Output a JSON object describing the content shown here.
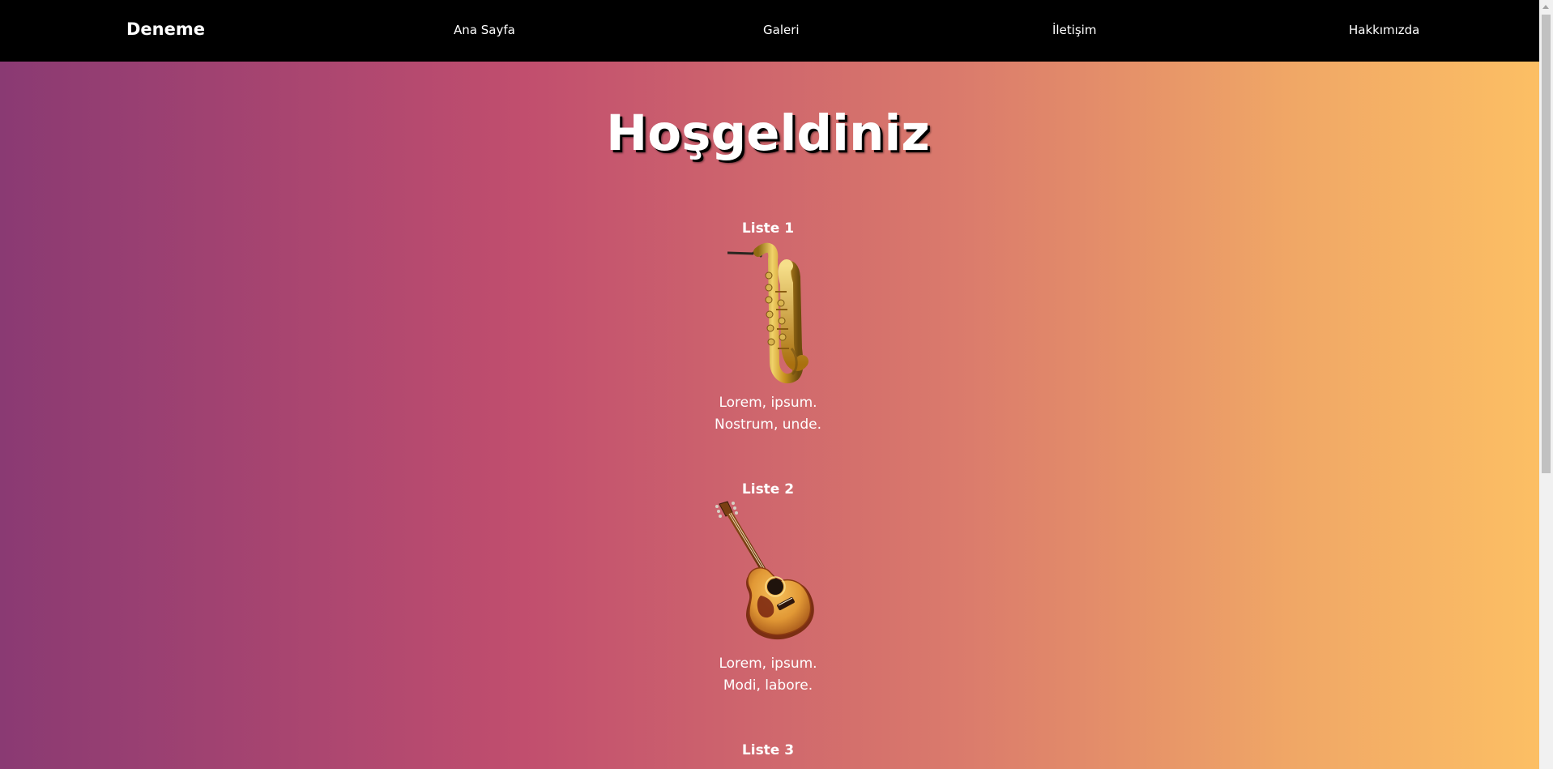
{
  "window": {
    "title": "Deneme"
  },
  "nav": {
    "brand": "Deneme",
    "links": [
      "Ana Sayfa",
      "Galeri",
      "İletişim",
      "Hakkımızda"
    ]
  },
  "hero": {
    "title": "Hoşgeldiniz"
  },
  "sections": [
    {
      "title": "Liste 1",
      "lines": [
        "Lorem, ipsum.",
        "Nostrum, unde."
      ],
      "image": "saxophone-image"
    },
    {
      "title": "Liste 2",
      "lines": [
        "Lorem, ipsum.",
        "Modi, labore."
      ],
      "image": "guitar-image"
    },
    {
      "title": "Liste 3"
    }
  ],
  "colors": {
    "navbar": "#000000",
    "text": "#ffffff",
    "gradient": [
      "#8a3a73",
      "#c14e6e",
      "#da7a6c",
      "#f0a766",
      "#fcbf64"
    ]
  },
  "icons": {
    "scroll_up": "chevron-up-icon"
  }
}
